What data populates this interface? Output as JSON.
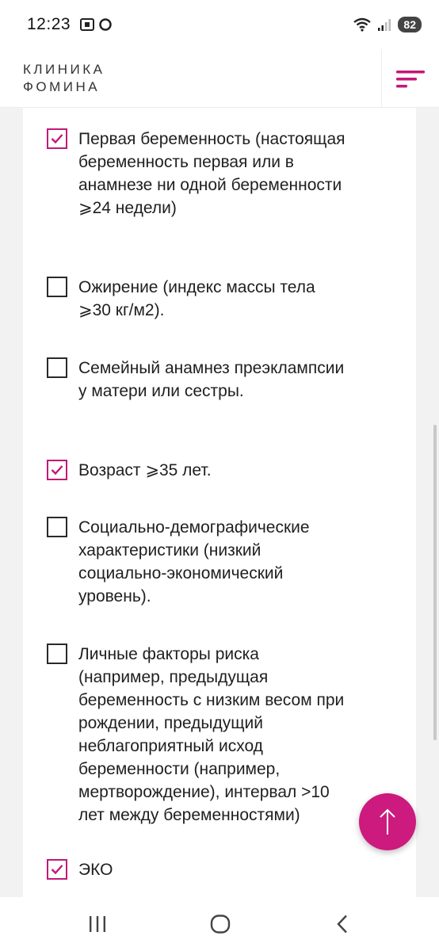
{
  "status_bar": {
    "time": "12:23",
    "battery": "82",
    "icons": [
      "screenshot-icon",
      "messenger-icon",
      "wifi-icon",
      "signal-icon"
    ]
  },
  "header": {
    "logo_line1": "КЛИНИКА",
    "logo_line2": "ФОМИНА",
    "menu_icon": "menu-icon"
  },
  "colors": {
    "accent": "#c2187a",
    "fab": "#cc1a7e",
    "background": "#f2f2f2"
  },
  "checklist": [
    {
      "label": "Первая беременность (настоящая беременность первая или в анамнезе ни одной беременности ⩾24 недели)",
      "checked": true
    },
    {
      "label": "Ожирение (индекс массы тела ⩾30 кг/м2).",
      "checked": false
    },
    {
      "label": "Семейный анамнез преэклампсии у матери или сестры.",
      "checked": false
    },
    {
      "label": "Возраст ⩾35 лет.",
      "checked": true
    },
    {
      "label": "Социально-демографические характеристики (низкий социально-экономический уровень).",
      "checked": false
    },
    {
      "label": "Личные факторы риска (например, предыдущая беременность с низким весом при рождении, предыдущий неблагоприятный исход беременности (например, мертворождение), интервал >10 лет между беременностями)",
      "checked": false
    },
    {
      "label": "ЭКО",
      "checked": true
    }
  ],
  "fab": {
    "icon": "arrow-up-icon"
  },
  "nav_bar": {
    "icons": [
      "recent-apps-icon",
      "home-icon",
      "back-icon"
    ]
  }
}
